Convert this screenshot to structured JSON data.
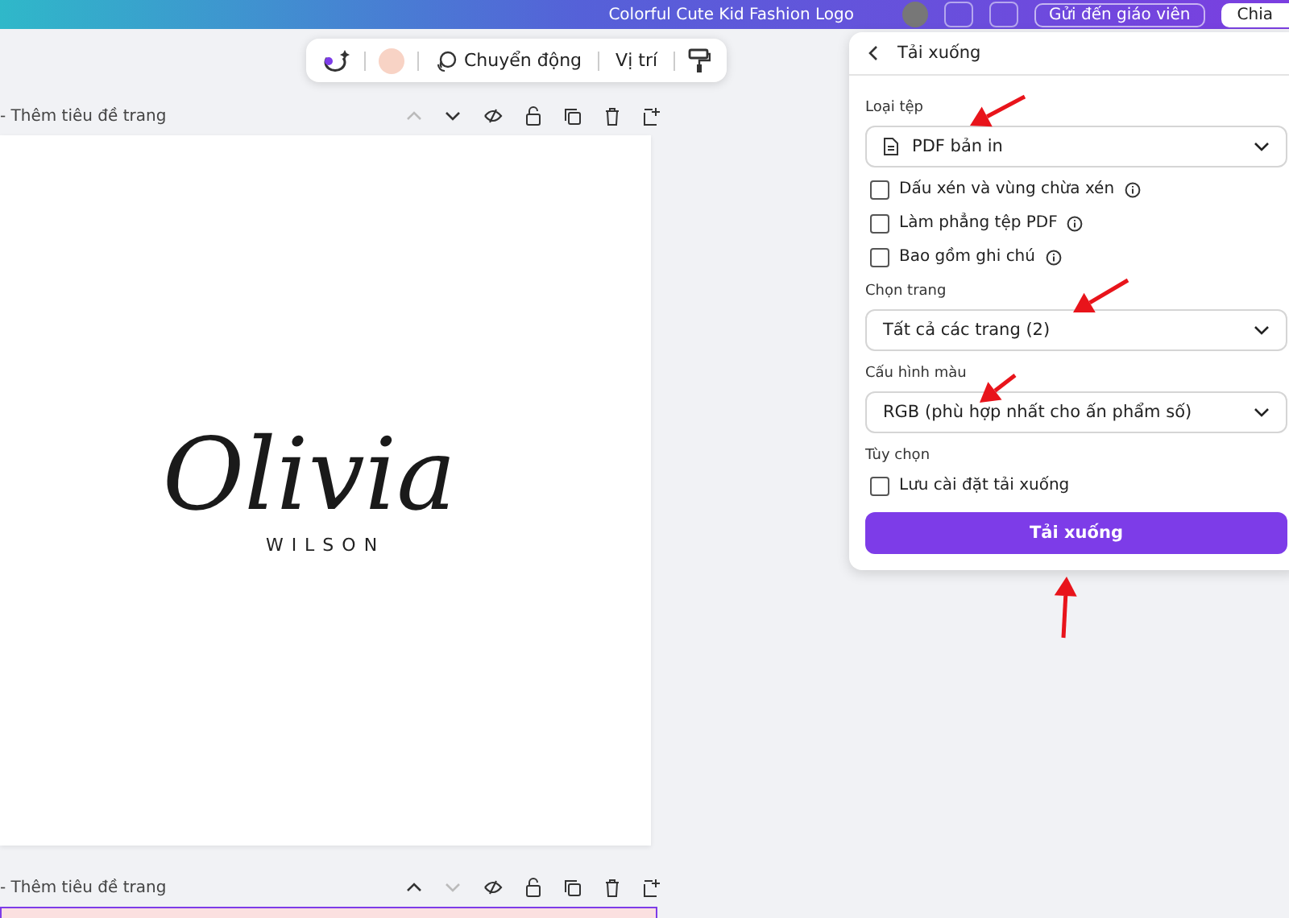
{
  "header": {
    "title": "Colorful Cute Kid Fashion Logo",
    "send_button": "Gửi đến giáo viên",
    "share_button": "Chia"
  },
  "toolbar": {
    "color": "#f8d3c5",
    "items": [
      "Chuyển động",
      "Vị trí"
    ]
  },
  "pages": [
    {
      "title": "- Thêm tiêu đề trang",
      "up_disabled": true,
      "down_disabled": false,
      "kind": "logo",
      "logo": {
        "name": "Olivia",
        "surname": "WILSON"
      }
    },
    {
      "title": "- Thêm tiêu đề trang",
      "up_disabled": false,
      "down_disabled": true,
      "kind": "blank"
    }
  ],
  "panel": {
    "title": "Tải xuống",
    "file_type": {
      "label": "Loại tệp",
      "value": "PDF bản in"
    },
    "file_options": [
      {
        "label": "Dấu xén và vùng chừa xén",
        "checked": false
      },
      {
        "label": "Làm phẳng tệp PDF",
        "checked": false
      },
      {
        "label": "Bao gồm ghi chú",
        "checked": false
      }
    ],
    "pages": {
      "label": "Chọn trang",
      "value": "Tất cả các trang (2)"
    },
    "color_profile": {
      "label": "Cấu hình màu",
      "value": "RGB (phù hợp nhất cho ấn phẩm số)"
    },
    "options_label": "Tùy chọn",
    "save_settings": {
      "label": "Lưu cài đặt tải xuống",
      "checked": false
    },
    "download_button": "Tải xuống"
  }
}
